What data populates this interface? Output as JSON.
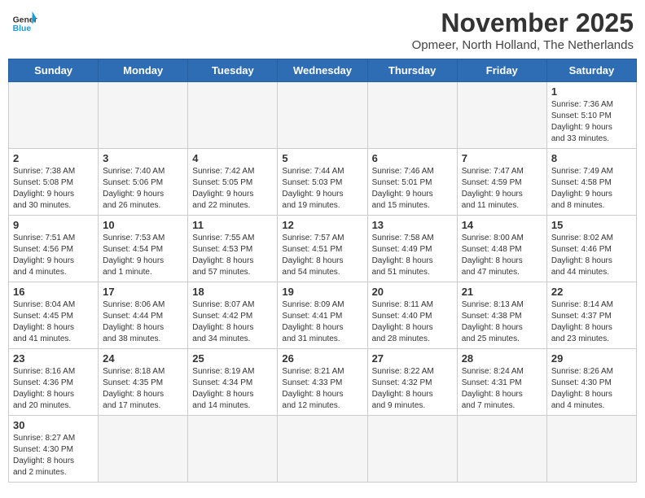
{
  "header": {
    "logo_general": "General",
    "logo_blue": "Blue",
    "month_title": "November 2025",
    "location": "Opmeer, North Holland, The Netherlands"
  },
  "days_of_week": [
    "Sunday",
    "Monday",
    "Tuesday",
    "Wednesday",
    "Thursday",
    "Friday",
    "Saturday"
  ],
  "weeks": [
    [
      {
        "day": "",
        "info": ""
      },
      {
        "day": "",
        "info": ""
      },
      {
        "day": "",
        "info": ""
      },
      {
        "day": "",
        "info": ""
      },
      {
        "day": "",
        "info": ""
      },
      {
        "day": "",
        "info": ""
      },
      {
        "day": "1",
        "info": "Sunrise: 7:36 AM\nSunset: 5:10 PM\nDaylight: 9 hours\nand 33 minutes."
      }
    ],
    [
      {
        "day": "2",
        "info": "Sunrise: 7:38 AM\nSunset: 5:08 PM\nDaylight: 9 hours\nand 30 minutes."
      },
      {
        "day": "3",
        "info": "Sunrise: 7:40 AM\nSunset: 5:06 PM\nDaylight: 9 hours\nand 26 minutes."
      },
      {
        "day": "4",
        "info": "Sunrise: 7:42 AM\nSunset: 5:05 PM\nDaylight: 9 hours\nand 22 minutes."
      },
      {
        "day": "5",
        "info": "Sunrise: 7:44 AM\nSunset: 5:03 PM\nDaylight: 9 hours\nand 19 minutes."
      },
      {
        "day": "6",
        "info": "Sunrise: 7:46 AM\nSunset: 5:01 PM\nDaylight: 9 hours\nand 15 minutes."
      },
      {
        "day": "7",
        "info": "Sunrise: 7:47 AM\nSunset: 4:59 PM\nDaylight: 9 hours\nand 11 minutes."
      },
      {
        "day": "8",
        "info": "Sunrise: 7:49 AM\nSunset: 4:58 PM\nDaylight: 9 hours\nand 8 minutes."
      }
    ],
    [
      {
        "day": "9",
        "info": "Sunrise: 7:51 AM\nSunset: 4:56 PM\nDaylight: 9 hours\nand 4 minutes."
      },
      {
        "day": "10",
        "info": "Sunrise: 7:53 AM\nSunset: 4:54 PM\nDaylight: 9 hours\nand 1 minute."
      },
      {
        "day": "11",
        "info": "Sunrise: 7:55 AM\nSunset: 4:53 PM\nDaylight: 8 hours\nand 57 minutes."
      },
      {
        "day": "12",
        "info": "Sunrise: 7:57 AM\nSunset: 4:51 PM\nDaylight: 8 hours\nand 54 minutes."
      },
      {
        "day": "13",
        "info": "Sunrise: 7:58 AM\nSunset: 4:49 PM\nDaylight: 8 hours\nand 51 minutes."
      },
      {
        "day": "14",
        "info": "Sunrise: 8:00 AM\nSunset: 4:48 PM\nDaylight: 8 hours\nand 47 minutes."
      },
      {
        "day": "15",
        "info": "Sunrise: 8:02 AM\nSunset: 4:46 PM\nDaylight: 8 hours\nand 44 minutes."
      }
    ],
    [
      {
        "day": "16",
        "info": "Sunrise: 8:04 AM\nSunset: 4:45 PM\nDaylight: 8 hours\nand 41 minutes."
      },
      {
        "day": "17",
        "info": "Sunrise: 8:06 AM\nSunset: 4:44 PM\nDaylight: 8 hours\nand 38 minutes."
      },
      {
        "day": "18",
        "info": "Sunrise: 8:07 AM\nSunset: 4:42 PM\nDaylight: 8 hours\nand 34 minutes."
      },
      {
        "day": "19",
        "info": "Sunrise: 8:09 AM\nSunset: 4:41 PM\nDaylight: 8 hours\nand 31 minutes."
      },
      {
        "day": "20",
        "info": "Sunrise: 8:11 AM\nSunset: 4:40 PM\nDaylight: 8 hours\nand 28 minutes."
      },
      {
        "day": "21",
        "info": "Sunrise: 8:13 AM\nSunset: 4:38 PM\nDaylight: 8 hours\nand 25 minutes."
      },
      {
        "day": "22",
        "info": "Sunrise: 8:14 AM\nSunset: 4:37 PM\nDaylight: 8 hours\nand 23 minutes."
      }
    ],
    [
      {
        "day": "23",
        "info": "Sunrise: 8:16 AM\nSunset: 4:36 PM\nDaylight: 8 hours\nand 20 minutes."
      },
      {
        "day": "24",
        "info": "Sunrise: 8:18 AM\nSunset: 4:35 PM\nDaylight: 8 hours\nand 17 minutes."
      },
      {
        "day": "25",
        "info": "Sunrise: 8:19 AM\nSunset: 4:34 PM\nDaylight: 8 hours\nand 14 minutes."
      },
      {
        "day": "26",
        "info": "Sunrise: 8:21 AM\nSunset: 4:33 PM\nDaylight: 8 hours\nand 12 minutes."
      },
      {
        "day": "27",
        "info": "Sunrise: 8:22 AM\nSunset: 4:32 PM\nDaylight: 8 hours\nand 9 minutes."
      },
      {
        "day": "28",
        "info": "Sunrise: 8:24 AM\nSunset: 4:31 PM\nDaylight: 8 hours\nand 7 minutes."
      },
      {
        "day": "29",
        "info": "Sunrise: 8:26 AM\nSunset: 4:30 PM\nDaylight: 8 hours\nand 4 minutes."
      }
    ],
    [
      {
        "day": "30",
        "info": "Sunrise: 8:27 AM\nSunset: 4:30 PM\nDaylight: 8 hours\nand 2 minutes."
      },
      {
        "day": "",
        "info": ""
      },
      {
        "day": "",
        "info": ""
      },
      {
        "day": "",
        "info": ""
      },
      {
        "day": "",
        "info": ""
      },
      {
        "day": "",
        "info": ""
      },
      {
        "day": "",
        "info": ""
      }
    ]
  ]
}
